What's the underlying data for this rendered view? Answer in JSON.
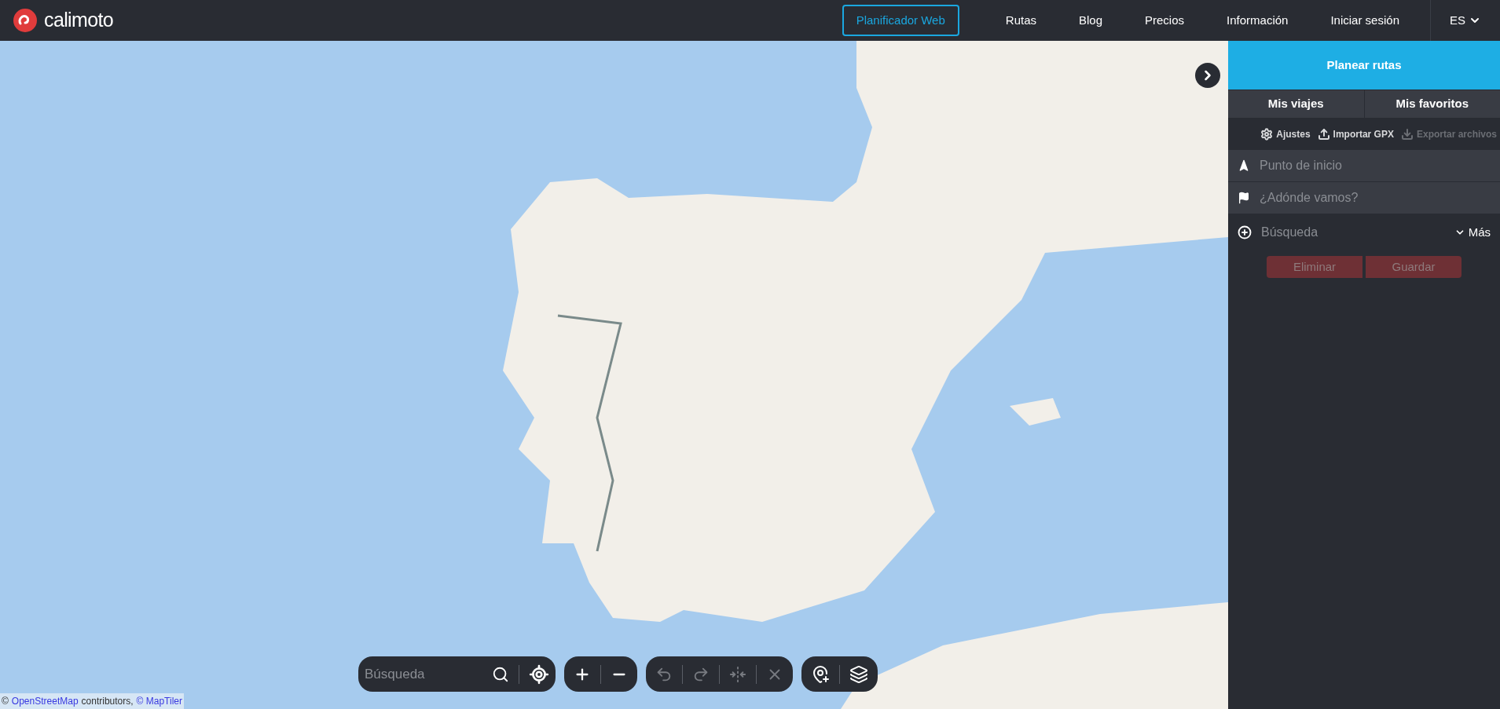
{
  "header": {
    "logo": "calimoto",
    "nav": [
      {
        "label": "Planificador Web",
        "selected": true
      },
      {
        "label": "Rutas",
        "selected": false
      },
      {
        "label": "Blog",
        "selected": false
      },
      {
        "label": "Precios",
        "selected": false
      },
      {
        "label": "Información",
        "selected": false
      },
      {
        "label": "Iniciar sesión",
        "selected": false
      }
    ],
    "language": "ES"
  },
  "map": {
    "controls": {
      "search_placeholder": "Búsqueda",
      "edit_tools": [
        {
          "kind": "undo",
          "disabled": true
        },
        {
          "kind": "redo",
          "disabled": true
        },
        {
          "kind": "merge",
          "disabled": true
        },
        {
          "kind": "clear",
          "disabled": true
        }
      ]
    },
    "attribution": [
      {
        "kind": "text",
        "text": "©"
      },
      {
        "kind": "link",
        "text": "OpenStreetMap"
      },
      {
        "kind": "text",
        "text": "contributors,"
      },
      {
        "kind": "link",
        "text": "© MapTiler"
      }
    ]
  },
  "sidebar": {
    "tabs": [
      {
        "label": "Planear rutas",
        "selected": true
      },
      {
        "label": "Mis viajes",
        "selected": false
      },
      {
        "label": "Mis favoritos",
        "selected": false
      }
    ],
    "tools": [
      {
        "kind": "settings",
        "label": "Ajustes",
        "disabled": false
      },
      {
        "kind": "upload",
        "label": "Importar GPX",
        "disabled": false
      },
      {
        "kind": "download",
        "label": "Exportar archivos",
        "disabled": true
      }
    ],
    "waypoints": [
      {
        "kind": "start",
        "placeholder": "Punto de inicio"
      },
      {
        "kind": "destination",
        "placeholder": "¿Adónde vamos?"
      }
    ],
    "search": {
      "placeholder": "Búsqueda"
    },
    "more": "Más",
    "actions": [
      {
        "label": "Eliminar",
        "disabled": true
      },
      {
        "label": "Guardar",
        "disabled": true
      }
    ]
  }
}
